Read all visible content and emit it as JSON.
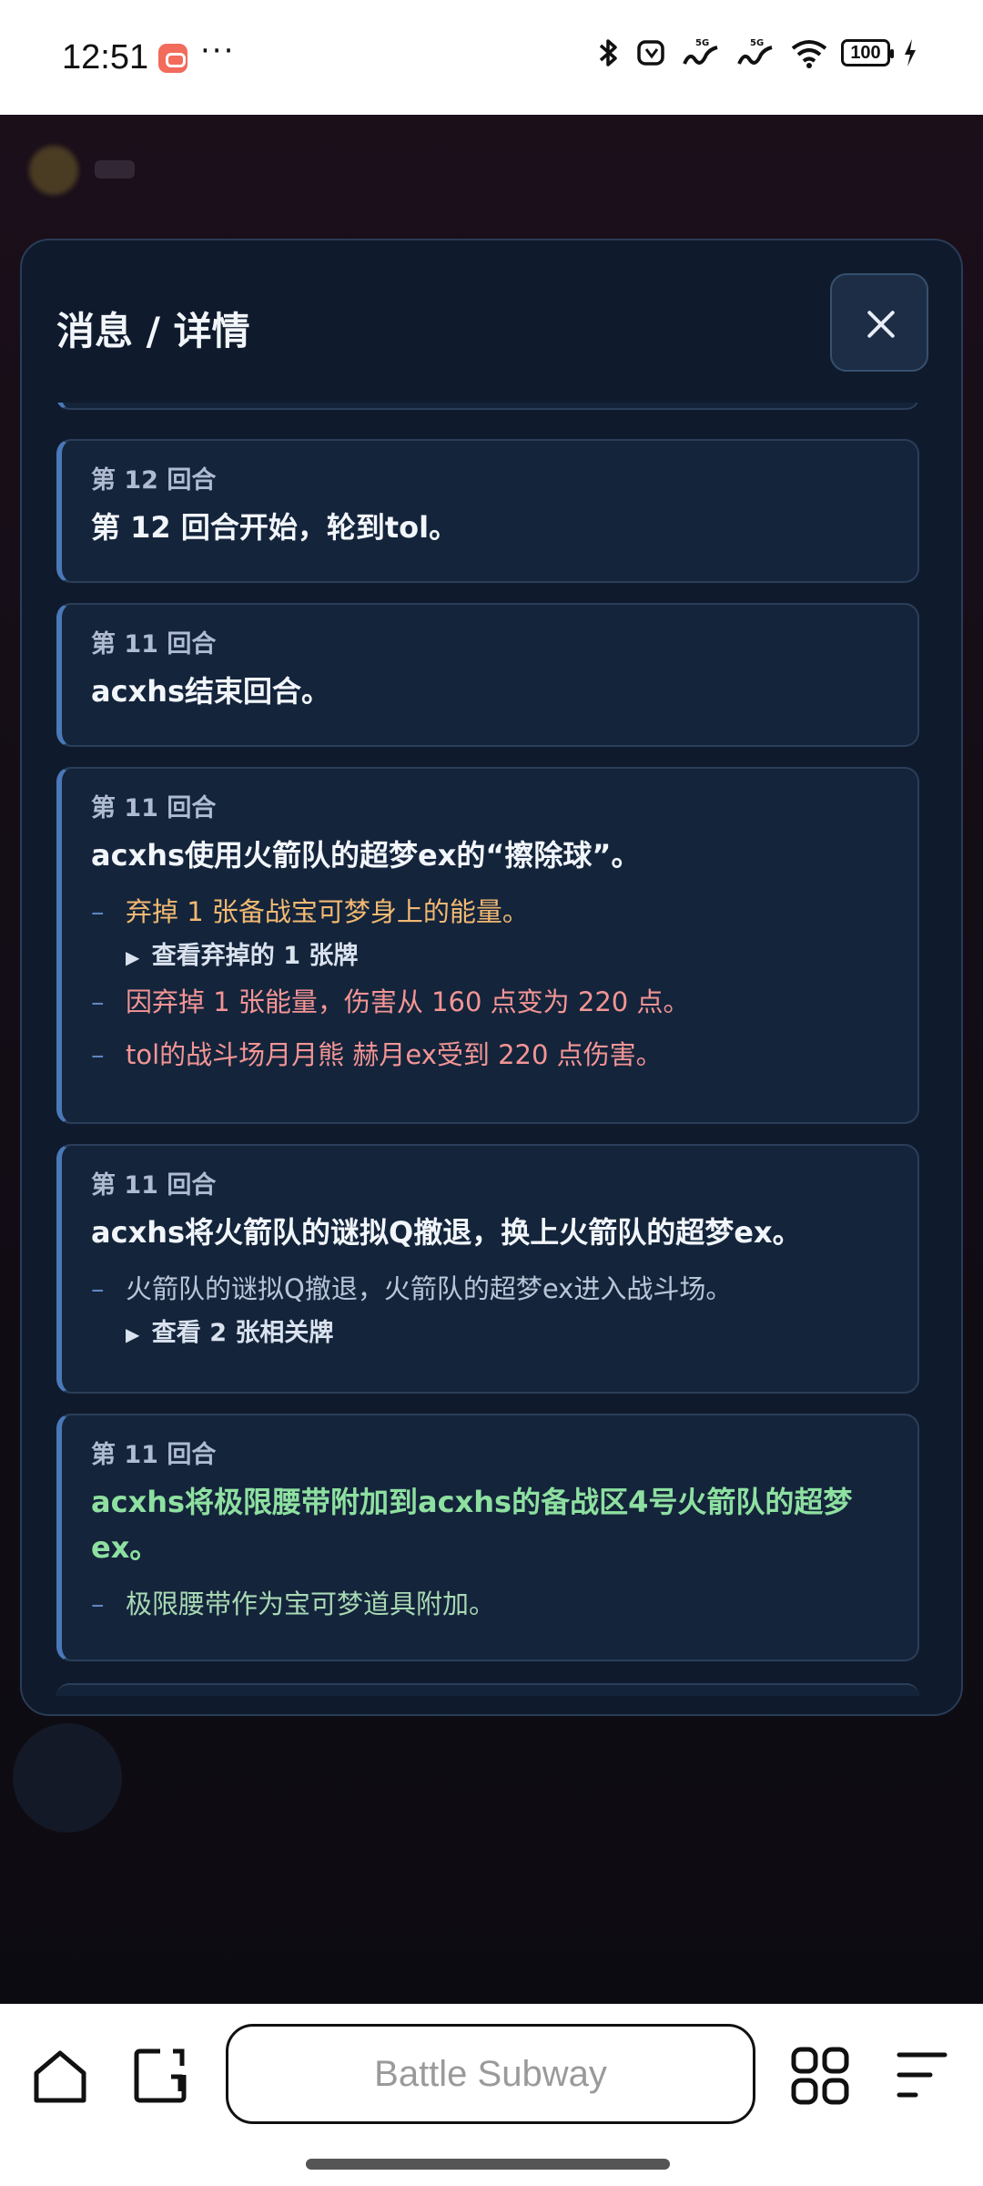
{
  "status_bar": {
    "time": "12:51",
    "dots": "···",
    "battery": "100",
    "icons": [
      "bluetooth-icon",
      "nfc-icon",
      "signal-5g-icon",
      "signal-5g-icon",
      "wifi-icon",
      "battery-icon",
      "charging-icon"
    ]
  },
  "modal": {
    "title": "消息 / 详情",
    "close_icon": "close-icon"
  },
  "log_entries": [
    {
      "round": "第 12 回合",
      "main": "第 12 回合开始，轮到tol。",
      "details": []
    },
    {
      "round": "第 11 回合",
      "main": "acxhs结束回合。",
      "details": []
    },
    {
      "round": "第 11 回合",
      "main": "acxhs使用火箭队的超梦ex的“擦除球”。",
      "details": [
        {
          "dash": "–",
          "text": "弃掉 1 张备战宝可梦身上的能量。",
          "color": "#f2b972"
        },
        {
          "toggle": "▶",
          "text": "查看弃掉的 1 张牌"
        },
        {
          "dash": "–",
          "text": "因弃掉 1 张能量，伤害从 160 点变为 220 点。",
          "color": "#f39595"
        },
        {
          "dash": "–",
          "text": "tol的战斗场月月熊 赫月ex受到 220 点伤害。",
          "color": "#f39595"
        }
      ]
    },
    {
      "round": "第 11 回合",
      "main": "acxhs将火箭队的谜拟Q撤退，换上火箭队的超梦ex。",
      "details": [
        {
          "dash": "–",
          "text": "火箭队的谜拟Q撤退，火箭队的超梦ex进入战斗场。",
          "color": "#b9c6d8"
        },
        {
          "toggle": "▶",
          "text": "查看 2 张相关牌"
        }
      ]
    },
    {
      "round": "第 11 回合",
      "main": "acxhs将极限腰带附加到acxhs的备战区4号火箭队的超梦ex。",
      "main_color": "#8ee0a0",
      "details": [
        {
          "dash": "–",
          "text": "极限腰带作为宝可梦道具附加。",
          "color": "#a8d9b4"
        }
      ]
    }
  ],
  "nav_bar": {
    "url_text": "Battle Subway",
    "icons": [
      "home-icon",
      "tabs-icon",
      "apps-grid-icon",
      "menu-icon"
    ]
  }
}
